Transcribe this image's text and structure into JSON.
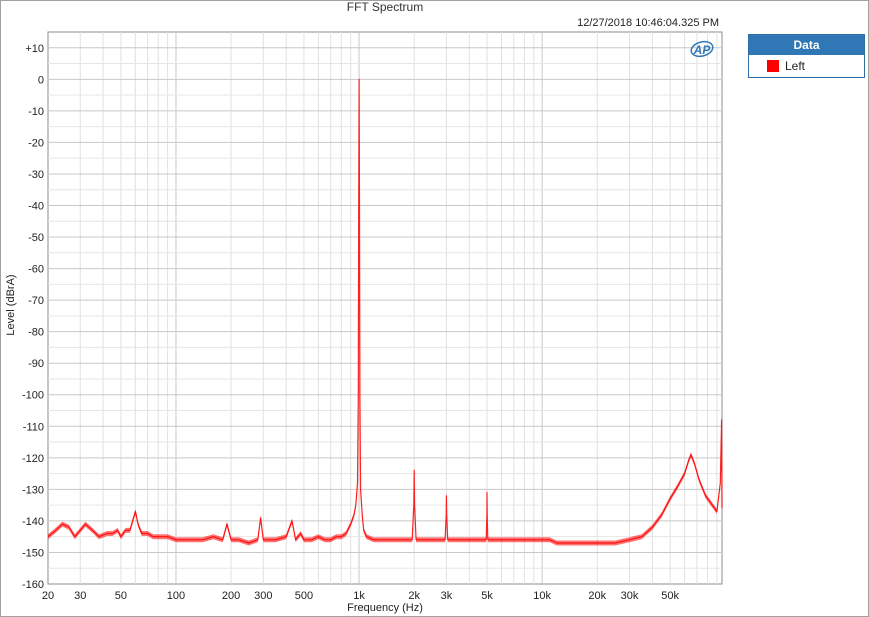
{
  "timestamp": "12/27/2018 10:46:04.325 PM",
  "logo_text": "AP",
  "legend": {
    "header": "Data",
    "items": [
      {
        "label": "Left",
        "color": "#ff0000"
      }
    ]
  },
  "chart_data": {
    "type": "line",
    "title": "FFT Spectrum",
    "xlabel": "Frequency (Hz)",
    "ylabel": "Level (dBrA)",
    "x_scale": "log",
    "xlim": [
      20,
      96000
    ],
    "ylim": [
      -160,
      15
    ],
    "grid": true,
    "legend_position": "right",
    "x_ticks": [
      {
        "value": 20,
        "label": "20"
      },
      {
        "value": 30,
        "label": "30"
      },
      {
        "value": 50,
        "label": "50"
      },
      {
        "value": 100,
        "label": "100"
      },
      {
        "value": 200,
        "label": "200"
      },
      {
        "value": 300,
        "label": "300"
      },
      {
        "value": 500,
        "label": "500"
      },
      {
        "value": 1000,
        "label": "1k"
      },
      {
        "value": 2000,
        "label": "2k"
      },
      {
        "value": 3000,
        "label": "3k"
      },
      {
        "value": 5000,
        "label": "5k"
      },
      {
        "value": 10000,
        "label": "10k"
      },
      {
        "value": 20000,
        "label": "20k"
      },
      {
        "value": 30000,
        "label": "30k"
      },
      {
        "value": 50000,
        "label": "50k"
      }
    ],
    "y_ticks": [
      {
        "value": 10,
        "label": "+10"
      },
      {
        "value": 0,
        "label": "0"
      },
      {
        "value": -10,
        "label": "-10"
      },
      {
        "value": -20,
        "label": "-20"
      },
      {
        "value": -30,
        "label": "-30"
      },
      {
        "value": -40,
        "label": "-40"
      },
      {
        "value": -50,
        "label": "-50"
      },
      {
        "value": -60,
        "label": "-60"
      },
      {
        "value": -70,
        "label": "-70"
      },
      {
        "value": -80,
        "label": "-80"
      },
      {
        "value": -90,
        "label": "-90"
      },
      {
        "value": -100,
        "label": "-100"
      },
      {
        "value": -110,
        "label": "-110"
      },
      {
        "value": -120,
        "label": "-120"
      },
      {
        "value": -130,
        "label": "-130"
      },
      {
        "value": -140,
        "label": "-140"
      },
      {
        "value": -150,
        "label": "-150"
      },
      {
        "value": -160,
        "label": "-160"
      }
    ],
    "series": [
      {
        "name": "Left",
        "color": "#ff0000",
        "x": [
          20,
          22,
          24,
          26,
          28,
          30,
          32,
          35,
          38,
          42,
          45,
          48,
          50,
          53,
          56,
          58,
          60,
          62,
          65,
          70,
          75,
          80,
          90,
          100,
          110,
          120,
          140,
          160,
          180,
          190,
          200,
          220,
          250,
          280,
          290,
          300,
          320,
          350,
          400,
          430,
          450,
          480,
          500,
          550,
          600,
          650,
          700,
          750,
          800,
          850,
          900,
          940,
          960,
          980,
          990,
          995,
          1000,
          1005,
          1010,
          1020,
          1040,
          1060,
          1100,
          1200,
          1400,
          1600,
          1800,
          1950,
          1990,
          2000,
          2010,
          2050,
          2200,
          2500,
          2800,
          2950,
          2990,
          3000,
          3010,
          3050,
          3300,
          3700,
          4200,
          4700,
          4950,
          4990,
          5000,
          5010,
          5050,
          5600,
          6500,
          7500,
          8500,
          9500,
          10000,
          11000,
          12000,
          13000,
          14000,
          15000,
          17000,
          20000,
          25000,
          30000,
          35000,
          40000,
          45000,
          50000,
          55000,
          60000,
          63000,
          65000,
          68000,
          72000,
          78000,
          85000,
          90000,
          94000,
          95500,
          96000
        ],
        "y": [
          -145,
          -143,
          -141,
          -142,
          -145,
          -143,
          -141,
          -143,
          -145,
          -144,
          -144,
          -143,
          -145,
          -143,
          -143,
          -140,
          -137,
          -141,
          -144,
          -144,
          -145,
          -145,
          -145,
          -146,
          -146,
          -146,
          -146,
          -145,
          -146,
          -141,
          -146,
          -146,
          -147,
          -146,
          -139,
          -146,
          -146,
          -146,
          -145,
          -140,
          -146,
          -144,
          -146,
          -146,
          -145,
          -146,
          -146,
          -145,
          -145,
          -144,
          -141,
          -138,
          -135,
          -128,
          -100,
          -40,
          0,
          -40,
          -100,
          -130,
          -138,
          -143,
          -145,
          -146,
          -146,
          -146,
          -146,
          -146,
          -135,
          -124,
          -135,
          -146,
          -146,
          -146,
          -146,
          -146,
          -138,
          -132,
          -138,
          -146,
          -146,
          -146,
          -146,
          -146,
          -146,
          -138,
          -131,
          -138,
          -146,
          -146,
          -146,
          -146,
          -146,
          -146,
          -146,
          -146,
          -147,
          -147,
          -147,
          -147,
          -147,
          -147,
          -147,
          -146,
          -145,
          -142,
          -138,
          -133,
          -129,
          -125,
          -121,
          -119,
          -122,
          -127,
          -132,
          -135,
          -137,
          -128,
          -108,
          -136
        ]
      }
    ]
  }
}
